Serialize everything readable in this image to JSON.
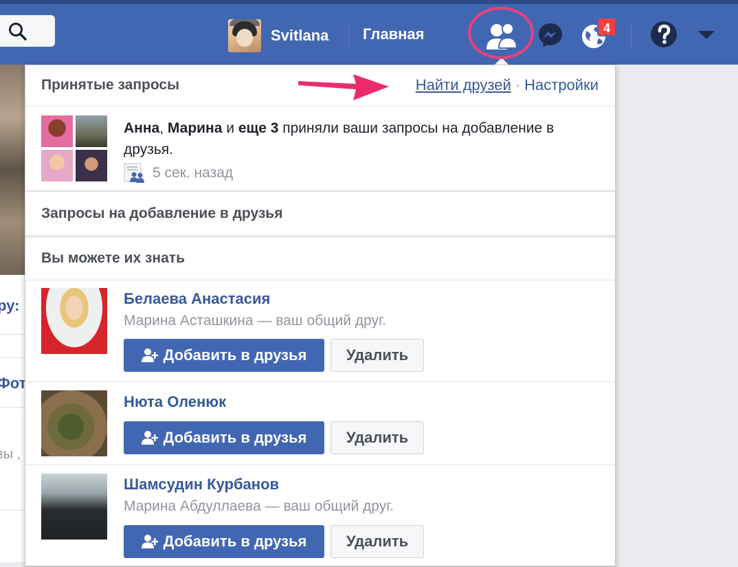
{
  "header": {
    "profile_name": "Svitlana",
    "home_label": "Главная",
    "notifications_count": "4"
  },
  "left_fragments": {
    "text1": "ру:",
    "text2": "Фот",
    "text3": "вы ,"
  },
  "dropdown": {
    "accepted_title": "Принятые запросы",
    "find_friends_link": "Найти друзей",
    "separator": "·",
    "settings_link": "Настройки",
    "notification": {
      "name1": "Анна",
      "comma": ", ",
      "name2": "Марина",
      "and_word": " и ",
      "others": "еще 3",
      "message": " приняли ваши запросы на добавление в друзья.",
      "time": "5 сек. назад"
    },
    "requests_title": "Запросы на добавление в друзья",
    "pymk_title": "Вы можете их знать",
    "people": [
      {
        "name": "Белаева Анастасия",
        "mutual": "Марина Асташкина — ваш общий друг.",
        "add_label": "Добавить в друзья",
        "delete_label": "Удалить"
      },
      {
        "name": "Нюта Оленюк",
        "mutual": "",
        "add_label": "Добавить в друзья",
        "delete_label": "Удалить"
      },
      {
        "name": "Шамсудин Курбанов",
        "mutual": "Марина Абдуллаева — ваш общий друг.",
        "add_label": "Добавить в друзья",
        "delete_label": "Удалить"
      }
    ]
  },
  "colors": {
    "topbar": "#4267b2",
    "link": "#365899",
    "highlight": "#ec407a",
    "badge": "#fa3e3e"
  }
}
